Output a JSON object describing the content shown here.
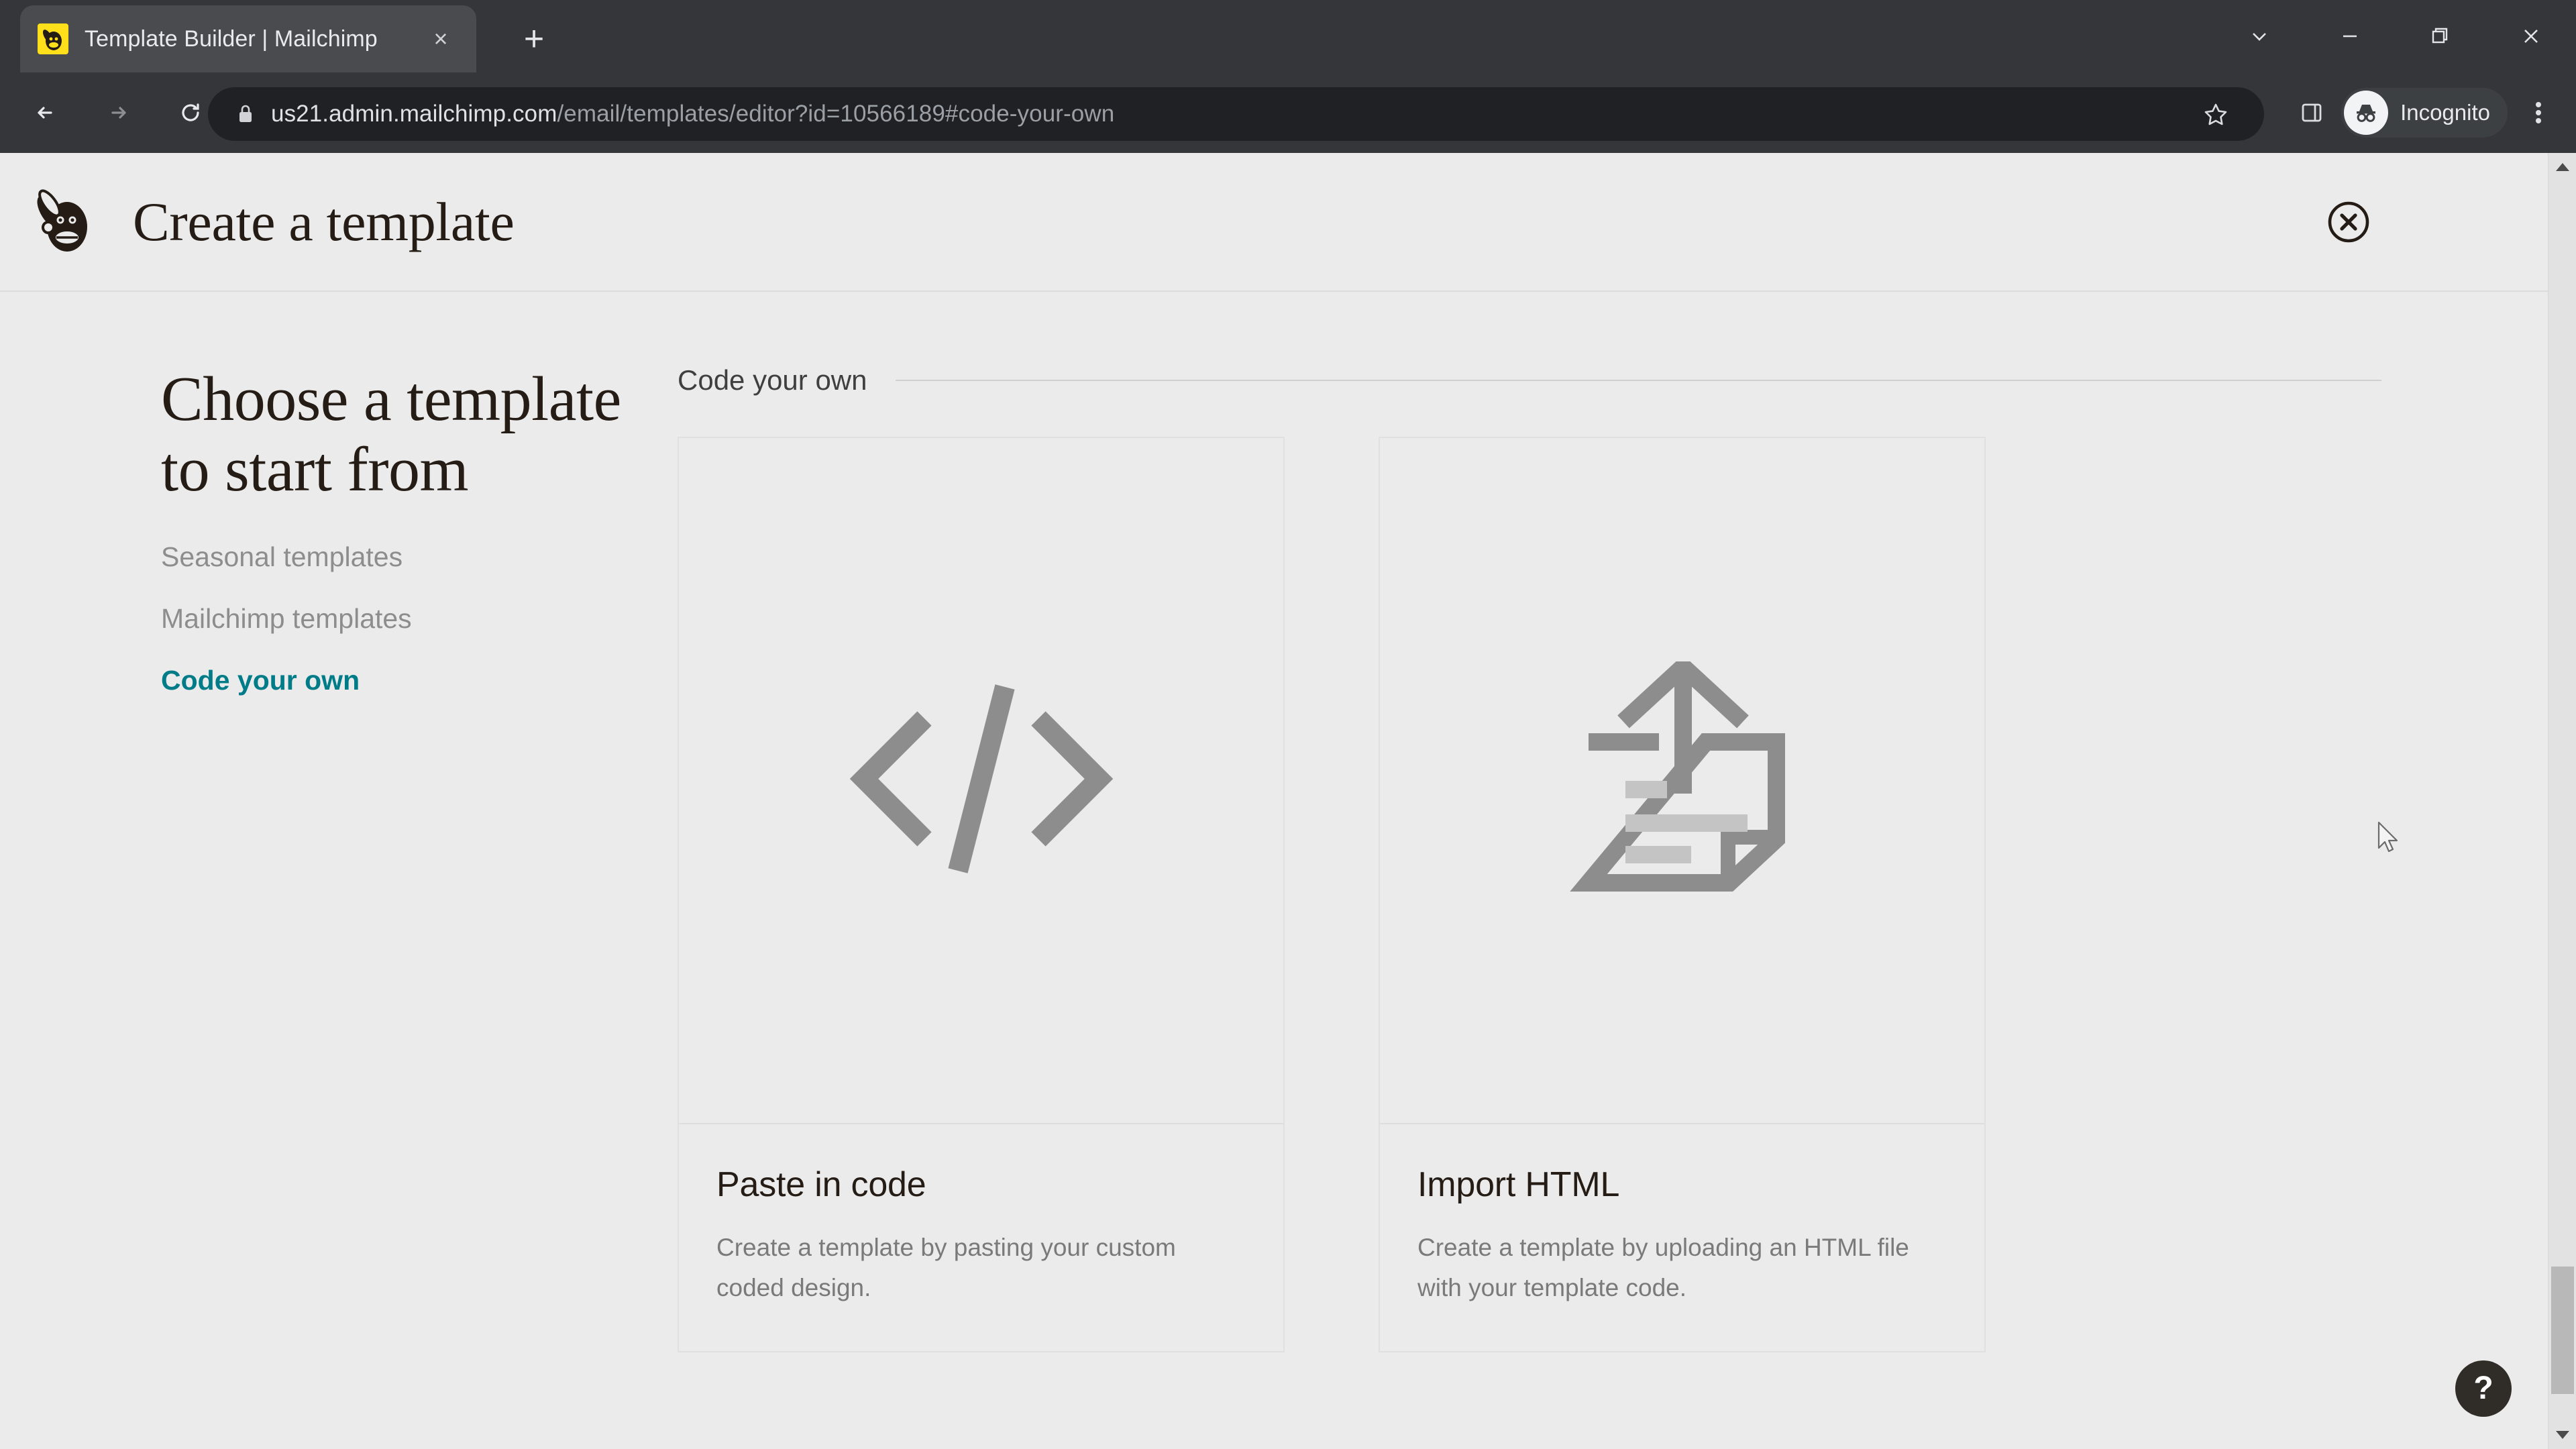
{
  "browser": {
    "tab": {
      "title": "Template Builder | Mailchimp",
      "favicon": "mailchimp-favicon",
      "close": "×"
    },
    "new_tab_label": "+",
    "window_controls": [
      {
        "name": "tab-search-button",
        "icon": "chevron-down-icon"
      },
      {
        "name": "minimize-button",
        "icon": "minimize-icon"
      },
      {
        "name": "restore-button",
        "icon": "restore-icon"
      },
      {
        "name": "close-window-button",
        "icon": "close-icon"
      }
    ],
    "nav": {
      "back": "back-arrow-icon",
      "forward": "forward-arrow-icon",
      "reload": "reload-icon"
    },
    "omnibox": {
      "lock_icon": "lock-icon",
      "url_domain": "us21.admin.mailchimp.com",
      "url_path": "/email/templates/editor?id=10566189#code-your-own",
      "full_url": "us21.admin.mailchimp.com/email/templates/editor?id=10566189#code-your-own",
      "bookmark_icon": "star-icon",
      "side_panel_icon": "side-panel-icon"
    },
    "profile": {
      "label": "Incognito",
      "icon": "incognito-icon"
    },
    "menu_icon": "kebab-menu-icon"
  },
  "page": {
    "logo": "mailchimp-logo",
    "title": "Create a template",
    "close_button": "close-circle-icon"
  },
  "sidebar": {
    "heading": "Choose a template to start from",
    "items": [
      {
        "label": "Seasonal templates",
        "active": false
      },
      {
        "label": "Mailchimp templates",
        "active": false
      },
      {
        "label": "Code your own",
        "active": true
      }
    ]
  },
  "main": {
    "section_label": "Code your own",
    "cards": [
      {
        "icon": "code-brackets-icon",
        "title": "Paste in code",
        "description": "Create a template by pasting your custom coded design."
      },
      {
        "icon": "upload-document-icon",
        "title": "Import HTML",
        "description": "Create a template by uploading an HTML file with your template code."
      }
    ]
  },
  "help": {
    "label": "?",
    "name": "help-button"
  },
  "colors": {
    "accent_teal": "#007c89",
    "page_bg": "#ebebeb",
    "text_dark": "#241c15",
    "text_muted": "#8d8d8d",
    "icon_gray": "#8d8d8d",
    "chrome_bg": "#35363a",
    "omnibox_bg": "#202124",
    "favicon_yellow": "#ffe01b"
  }
}
